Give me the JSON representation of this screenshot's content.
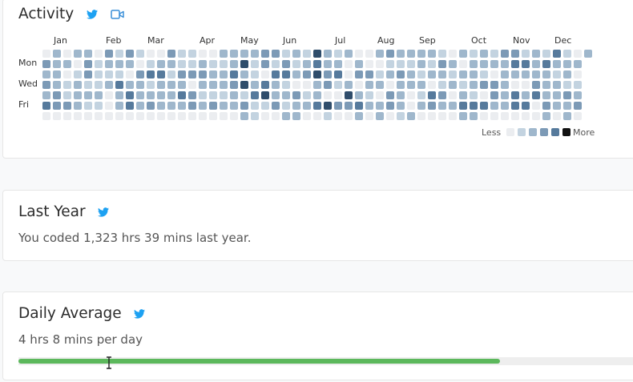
{
  "activity": {
    "title": "Activity",
    "months": [
      "Jan",
      "Feb",
      "Mar",
      "Apr",
      "May",
      "Jun",
      "Jul",
      "Aug",
      "Sep",
      "Oct",
      "Nov",
      "Dec"
    ],
    "day_labels": [
      "Mon",
      "Wed",
      "Fri"
    ],
    "legend": {
      "less": "Less",
      "more": "More"
    },
    "level_colors": [
      "#ebedf0",
      "#c3d3e0",
      "#9fb7cc",
      "#7c9ab6",
      "#567a9c",
      "#2f4d6b",
      "#111111"
    ],
    "share_icon": "twitter-icon",
    "video_icon": "video-camera-icon"
  },
  "last_year": {
    "title": "Last Year",
    "text": "You coded 1,323 hrs 39 mins last year.",
    "share_icon": "twitter-icon"
  },
  "daily_average": {
    "title": "Daily Average",
    "text": "4 hrs 8 mins per day",
    "progress_fraction": 0.77,
    "bar_color": "#5cb85c",
    "share_icon": "twitter-icon"
  }
}
